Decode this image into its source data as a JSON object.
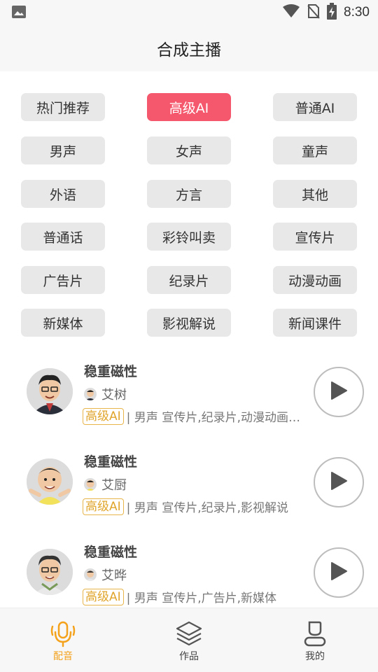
{
  "status_bar": {
    "time": "8:30"
  },
  "header": {
    "title": "合成主播"
  },
  "tags": [
    {
      "label": "热门推荐",
      "active": false
    },
    {
      "label": "高级AI",
      "active": true
    },
    {
      "label": "普通AI",
      "active": false
    },
    {
      "label": "男声",
      "active": false
    },
    {
      "label": "女声",
      "active": false
    },
    {
      "label": "童声",
      "active": false
    },
    {
      "label": "外语",
      "active": false
    },
    {
      "label": "方言",
      "active": false
    },
    {
      "label": "其他",
      "active": false
    },
    {
      "label": "普通话",
      "active": false
    },
    {
      "label": "彩铃叫卖",
      "active": false
    },
    {
      "label": "宣传片",
      "active": false
    },
    {
      "label": "广告片",
      "active": false
    },
    {
      "label": "纪录片",
      "active": false
    },
    {
      "label": "动漫动画",
      "active": false
    },
    {
      "label": "新媒体",
      "active": false
    },
    {
      "label": "影视解说",
      "active": false
    },
    {
      "label": "新闻课件",
      "active": false
    }
  ],
  "voices": [
    {
      "title": "稳重磁性",
      "author": "艾树",
      "badge": "高级AI",
      "desc": "| 男声 宣传片,纪录片,动漫动画…"
    },
    {
      "title": "稳重磁性",
      "author": "艾厨",
      "badge": "高级AI",
      "desc": "| 男声 宣传片,纪录片,影视解说"
    },
    {
      "title": "稳重磁性",
      "author": "艾晔",
      "badge": "高级AI",
      "desc": "| 男声 宣传片,广告片,新媒体"
    }
  ],
  "tab_bar": [
    {
      "label": "配音",
      "icon": "microphone-icon",
      "active": true
    },
    {
      "label": "作品",
      "icon": "layers-icon",
      "active": false
    },
    {
      "label": "我的",
      "icon": "user-icon",
      "active": false
    }
  ],
  "colors": {
    "accent": "#f5576c",
    "badge": "#e0a52c",
    "tab_active": "#f4a21c"
  }
}
